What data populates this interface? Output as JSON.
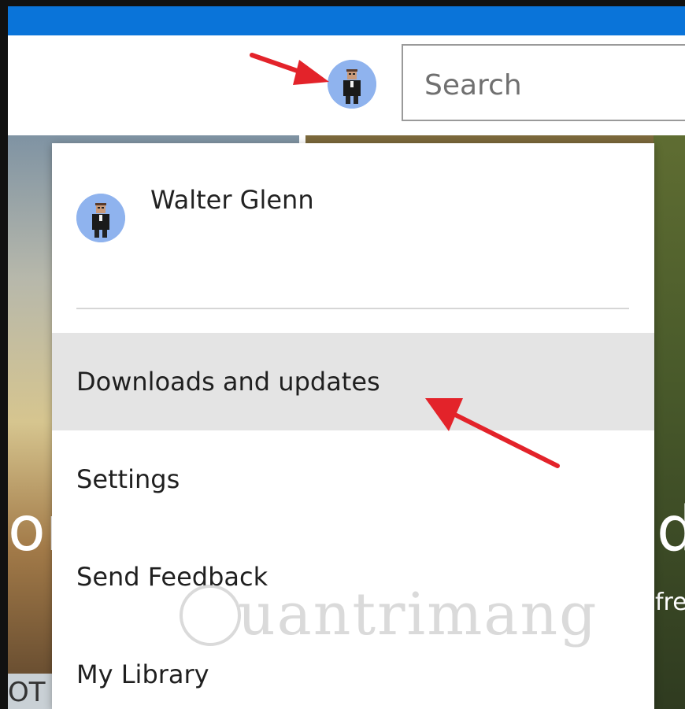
{
  "search": {
    "placeholder": "Search"
  },
  "background": {
    "left_fragment": "or",
    "right_fragment": "d",
    "right_subtext": "fre",
    "bottom_left_fragment": "OT"
  },
  "user_menu": {
    "user_name": "Walter Glenn",
    "items": [
      {
        "label": "Downloads and updates",
        "highlighted": true
      },
      {
        "label": "Settings"
      },
      {
        "label": "Send Feedback"
      },
      {
        "label": "My Library"
      }
    ]
  },
  "watermark": "uantrimang",
  "colors": {
    "titlebar": "#0a74d9",
    "avatar_bg": "#8fb3ee",
    "highlight": "#e4e4e4",
    "arrow": "#e3232a"
  }
}
